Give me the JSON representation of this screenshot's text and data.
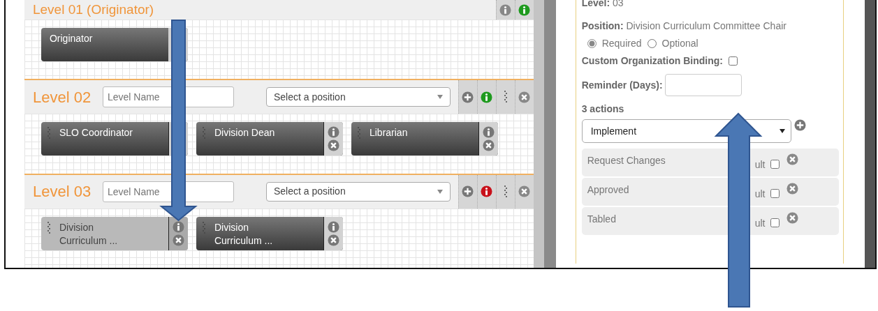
{
  "levels": [
    {
      "kind": "originator",
      "title": "Level 01 (Originator)",
      "color": "#1e9a1e",
      "positions": [
        {
          "label": "Originator",
          "selected": false
        }
      ]
    },
    {
      "kind": "position",
      "title": "Level 02",
      "name_placeholder": "Level Name",
      "position_select": "Select a position",
      "color": "#1e9a1e",
      "positions": [
        {
          "label": "SLO Coordinator",
          "selected": false
        },
        {
          "label": "Division Dean",
          "selected": false
        },
        {
          "label": "Librarian",
          "selected": false
        }
      ]
    },
    {
      "kind": "position",
      "title": "Level 03",
      "name_placeholder": "Level Name",
      "position_select": "Select a position",
      "color": "#c8101a",
      "positions": [
        {
          "label": "Division Curriculum ...",
          "selected": true
        },
        {
          "label": "Division Curriculum ...",
          "selected": false
        }
      ]
    }
  ],
  "details": {
    "level_label": "Level:",
    "level_value": "03",
    "position_label": "Position:",
    "position_value": "Division Curriculum Committee Chair",
    "requirement": [
      {
        "label": "Required",
        "selected": true
      },
      {
        "label": "Optional",
        "selected": false
      }
    ],
    "binding_label": "Custom Organization Binding:",
    "binding_checked": false,
    "reminder_label": "Reminder (Days):",
    "actions_title": "3 actions",
    "action_select": "Implement",
    "actions": [
      {
        "label": "Request Changes",
        "default_label": "ult",
        "default_checked": false
      },
      {
        "label": "Approved",
        "default_label": "ult",
        "default_checked": false
      },
      {
        "label": "Tabled",
        "default_label": "ult",
        "default_checked": false
      }
    ]
  }
}
